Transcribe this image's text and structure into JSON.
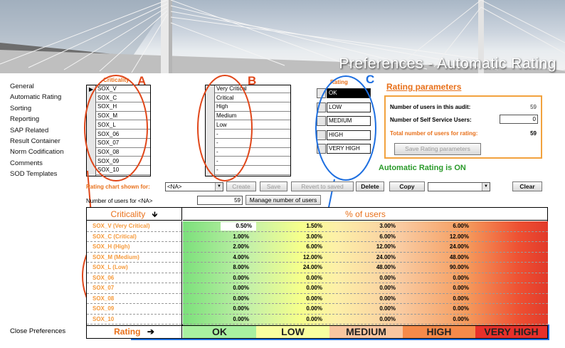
{
  "banner": {
    "title": "Preferences - Automatic Rating"
  },
  "sidebar": {
    "items": [
      {
        "label": "General"
      },
      {
        "label": "Automatic Rating"
      },
      {
        "label": "Sorting"
      },
      {
        "label": "Reporting"
      },
      {
        "label": "SAP Related"
      },
      {
        "label": "Result Container"
      },
      {
        "label": "Norm Codification"
      },
      {
        "label": "Comments"
      },
      {
        "label": "SOD Templates"
      }
    ],
    "close": "Close Preferences"
  },
  "annotations": {
    "a": "A",
    "b": "B",
    "c": "C"
  },
  "criticality_grid": {
    "header": "Criticality",
    "rows": [
      "SOX_V",
      "SOX_C",
      "SOX_H",
      "SOX_M",
      "SOX_L",
      "SOX_06",
      "SOX_07",
      "SOX_08",
      "SOX_09",
      "SOX_10"
    ]
  },
  "rating_name_grid": {
    "rows": [
      "Very Critical",
      "Critical",
      "High",
      "Medium",
      "Low",
      "-",
      "-",
      "-",
      "-",
      "-"
    ]
  },
  "rating_list": {
    "header": "Rating",
    "options": [
      "OK",
      "LOW",
      "MEDIUM",
      "HIGH",
      "VERY HIGH"
    ]
  },
  "rating_params": {
    "title": "Rating parameters",
    "users_in_audit_label": "Number of users in this audit:",
    "users_in_audit_value": "59",
    "self_service_label": "Number of Self Service Users:",
    "self_service_value": "0",
    "total_label": "Total number of users for rating:",
    "total_value": "59",
    "save_button": "Save Rating parameters"
  },
  "auto_status": "Automatic Rating is ON",
  "toolbar": {
    "chart_label": "Rating chart shown for:",
    "chart_select": "<NA>",
    "create": "Create",
    "save": "Save",
    "revert": "Revert to saved",
    "delete": "Delete",
    "copy": "Copy",
    "copy_select": "",
    "clear": "Clear",
    "users_for_label": "Number of users for <NA>",
    "users_for_value": "59",
    "manage_button": "Manage number of users"
  },
  "table": {
    "criticality_header": "Criticality",
    "percent_header": "% of users",
    "rows": [
      {
        "crit": "SOX_V (Very Critical)",
        "vals": [
          "0.50%",
          "1.50%",
          "3.00%",
          "6.00%"
        ]
      },
      {
        "crit": "SOX_C (Critical)",
        "vals": [
          "1.00%",
          "3.00%",
          "6.00%",
          "12.00%"
        ]
      },
      {
        "crit": "SOX_H (High)",
        "vals": [
          "2.00%",
          "6.00%",
          "12.00%",
          "24.00%"
        ]
      },
      {
        "crit": "SOX_M (Medium)",
        "vals": [
          "4.00%",
          "12.00%",
          "24.00%",
          "48.00%"
        ]
      },
      {
        "crit": "SOX_L (Low)",
        "vals": [
          "8.00%",
          "24.00%",
          "48.00%",
          "90.00%"
        ]
      },
      {
        "crit": "SOX_06",
        "vals": [
          "0.00%",
          "0.00%",
          "0.00%",
          "0.00%"
        ]
      },
      {
        "crit": "SOX_07",
        "vals": [
          "0.00%",
          "0.00%",
          "0.00%",
          "0.00%"
        ]
      },
      {
        "crit": "SOX_08",
        "vals": [
          "0.00%",
          "0.00%",
          "0.00%",
          "0.00%"
        ]
      },
      {
        "crit": "SOX_09",
        "vals": [
          "0.00%",
          "0.00%",
          "0.00%",
          "0.00%"
        ]
      },
      {
        "crit": "SOX_10",
        "vals": [
          "0.00%",
          "0.00%",
          "0.00%",
          "0.00%"
        ]
      }
    ]
  },
  "rating_bar": {
    "label": "Rating",
    "levels": [
      "OK",
      "LOW",
      "MEDIUM",
      "HIGH",
      "VERY HIGH"
    ]
  },
  "colors": {
    "accent_orange": "#e8701a",
    "annotation_red": "#e0471a",
    "annotation_blue": "#1e6fe0",
    "status_green": "#2a9a2a"
  }
}
